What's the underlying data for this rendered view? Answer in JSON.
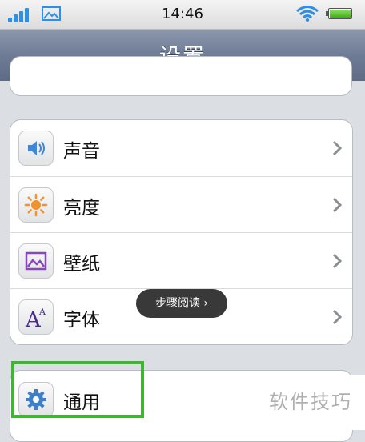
{
  "status_bar": {
    "time": "14:46",
    "icons": [
      "signal-icon",
      "gallery-icon",
      "wifi-icon",
      "battery-icon"
    ]
  },
  "nav": {
    "title": "设置"
  },
  "settings_group": {
    "rows": [
      {
        "label": "声音",
        "icon": "speaker-icon"
      },
      {
        "label": "亮度",
        "icon": "brightness-icon"
      },
      {
        "label": "壁纸",
        "icon": "wallpaper-icon"
      },
      {
        "label": "字体",
        "icon": "font-icon"
      }
    ]
  },
  "general_group": {
    "rows": [
      {
        "label": "通用",
        "icon": "gear-icon"
      }
    ]
  },
  "toast": {
    "label": "步骤阅读 ›"
  },
  "watermark": {
    "text": "软件技巧"
  },
  "colors": {
    "highlight": "#3fb631",
    "navbar": "#6f7c96",
    "accent": "#2f8fe2"
  }
}
